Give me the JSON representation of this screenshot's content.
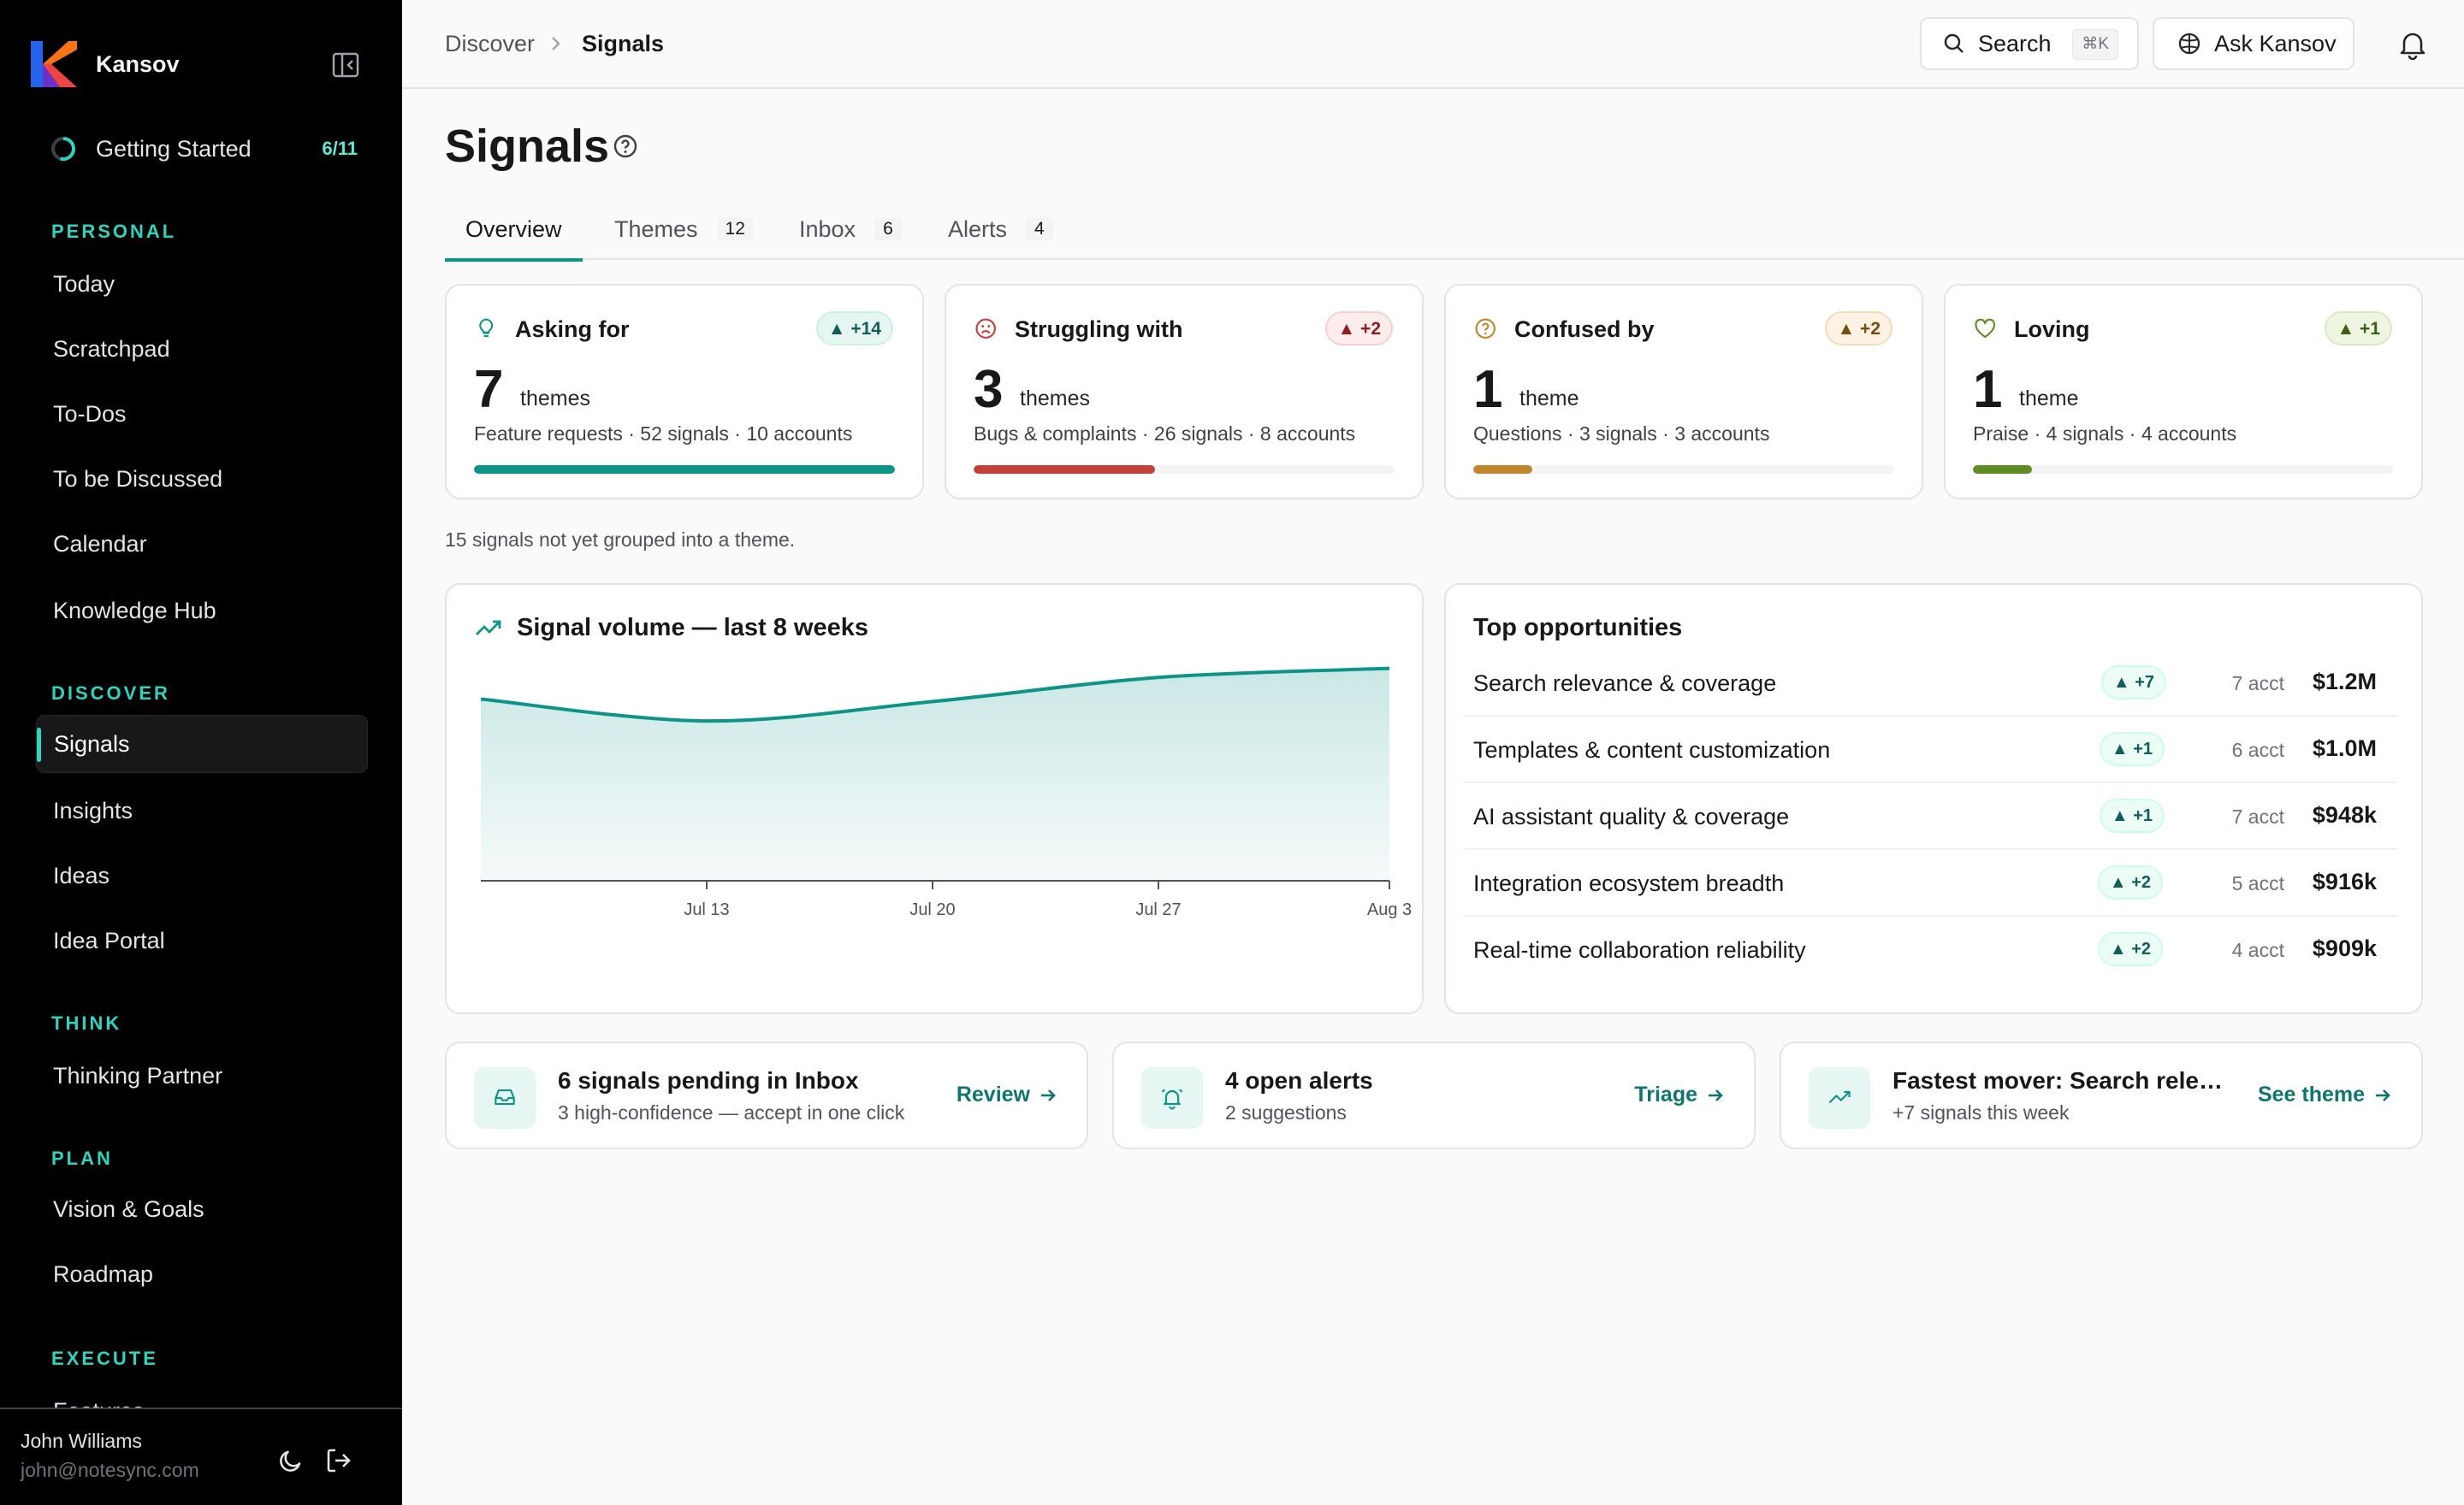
{
  "app": {
    "name": "Kansov"
  },
  "getting_started": {
    "label": "Getting Started",
    "progress": "6/11"
  },
  "sidebar": {
    "sections": {
      "personal": "PERSONAL",
      "discover": "DISCOVER",
      "think": "THINK",
      "plan": "PLAN",
      "execute": "EXECUTE"
    },
    "items": {
      "today": "Today",
      "scratchpad": "Scratchpad",
      "todos": "To-Dos",
      "to_be_discussed": "To be Discussed",
      "calendar": "Calendar",
      "knowledge_hub": "Knowledge Hub",
      "signals": "Signals",
      "insights": "Insights",
      "ideas": "Ideas",
      "idea_portal": "Idea Portal",
      "thinking_partner": "Thinking Partner",
      "vision_goals": "Vision & Goals",
      "roadmap": "Roadmap",
      "features": "Features"
    },
    "active": "signals"
  },
  "user": {
    "name": "John Williams",
    "email": "john@notesync.com"
  },
  "topbar": {
    "breadcrumb": [
      "Discover",
      "Signals"
    ],
    "search_label": "Search",
    "search_shortcut": "⌘K",
    "ask_label": "Ask Kansov"
  },
  "page": {
    "title": "Signals",
    "tabs": [
      {
        "label": "Overview",
        "count": ""
      },
      {
        "label": "Themes",
        "count": "12"
      },
      {
        "label": "Inbox",
        "count": "6"
      },
      {
        "label": "Alerts",
        "count": "4"
      }
    ],
    "active_tab": "Overview"
  },
  "stats": [
    {
      "title": "Asking for",
      "badge": "▲ +14",
      "number": "7",
      "unit": "themes",
      "desc": "Feature requests · 52 signals · 10 accounts",
      "fill": 1.0,
      "color": "#0d9488",
      "badge_bg": "#e6f6f3",
      "badge_border": "#ccefe8",
      "badge_text": "#115e59",
      "icon": "lightbulb-icon"
    },
    {
      "title": "Struggling with",
      "badge": "▲ +2",
      "number": "3",
      "unit": "themes",
      "desc": "Bugs & complaints · 26 signals · 8 accounts",
      "fill": 0.43,
      "color": "#c2413a",
      "badge_bg": "#fdecec",
      "badge_border": "#f7cfcf",
      "badge_text": "#8f1d1d",
      "icon": "frown-icon"
    },
    {
      "title": "Confused by",
      "badge": "▲ +2",
      "number": "1",
      "unit": "theme",
      "desc": "Questions · 3 signals · 3 accounts",
      "fill": 0.14,
      "color": "#c0862e",
      "badge_bg": "#fdf2e3",
      "badge_border": "#f3dcb8",
      "badge_text": "#7a4a0e",
      "icon": "question-circle-icon"
    },
    {
      "title": "Loving",
      "badge": "▲ +1",
      "number": "1",
      "unit": "theme",
      "desc": "Praise · 4 signals · 4 accounts",
      "fill": 0.14,
      "color": "#5f8c24",
      "badge_bg": "#eef6e2",
      "badge_border": "#d8e9bf",
      "badge_text": "#3d5d13",
      "icon": "heart-icon"
    }
  ],
  "ungrouped_note": "15 signals not yet grouped into a theme.",
  "chart_data": {
    "type": "area",
    "title": "Signal volume — last 8 weeks",
    "x_tick_labels": [
      "Jul 13",
      "Jul 20",
      "Jul 27",
      "Aug 3"
    ],
    "y": [
      0.83,
      0.73,
      0.82,
      0.93,
      0.97
    ],
    "ylim": [
      0,
      1
    ],
    "color": "#0d9488"
  },
  "opportunities": {
    "title": "Top opportunities",
    "rows": [
      {
        "name": "Search relevance & coverage",
        "delta": "▲ +7",
        "accounts": "7 acct",
        "value": "$1.2M"
      },
      {
        "name": "Templates & content customization",
        "delta": "▲ +1",
        "accounts": "6 acct",
        "value": "$1.0M"
      },
      {
        "name": "AI assistant quality & coverage",
        "delta": "▲ +1",
        "accounts": "7 acct",
        "value": "$948k"
      },
      {
        "name": "Integration ecosystem breadth",
        "delta": "▲ +2",
        "accounts": "5 acct",
        "value": "$916k"
      },
      {
        "name": "Real-time collaboration reliability",
        "delta": "▲ +2",
        "accounts": "4 acct",
        "value": "$909k"
      }
    ]
  },
  "actions": [
    {
      "title": "6 signals pending in Inbox",
      "sub": "3 high-confidence — accept in one click",
      "link": "Review",
      "icon": "inbox-icon"
    },
    {
      "title": "4 open alerts",
      "sub": "2 suggestions",
      "link": "Triage",
      "icon": "alarm-bell-icon"
    },
    {
      "title": "Fastest mover: Search releva...",
      "sub": "+7 signals this week",
      "link": "See theme",
      "icon": "trending-up-icon"
    }
  ]
}
